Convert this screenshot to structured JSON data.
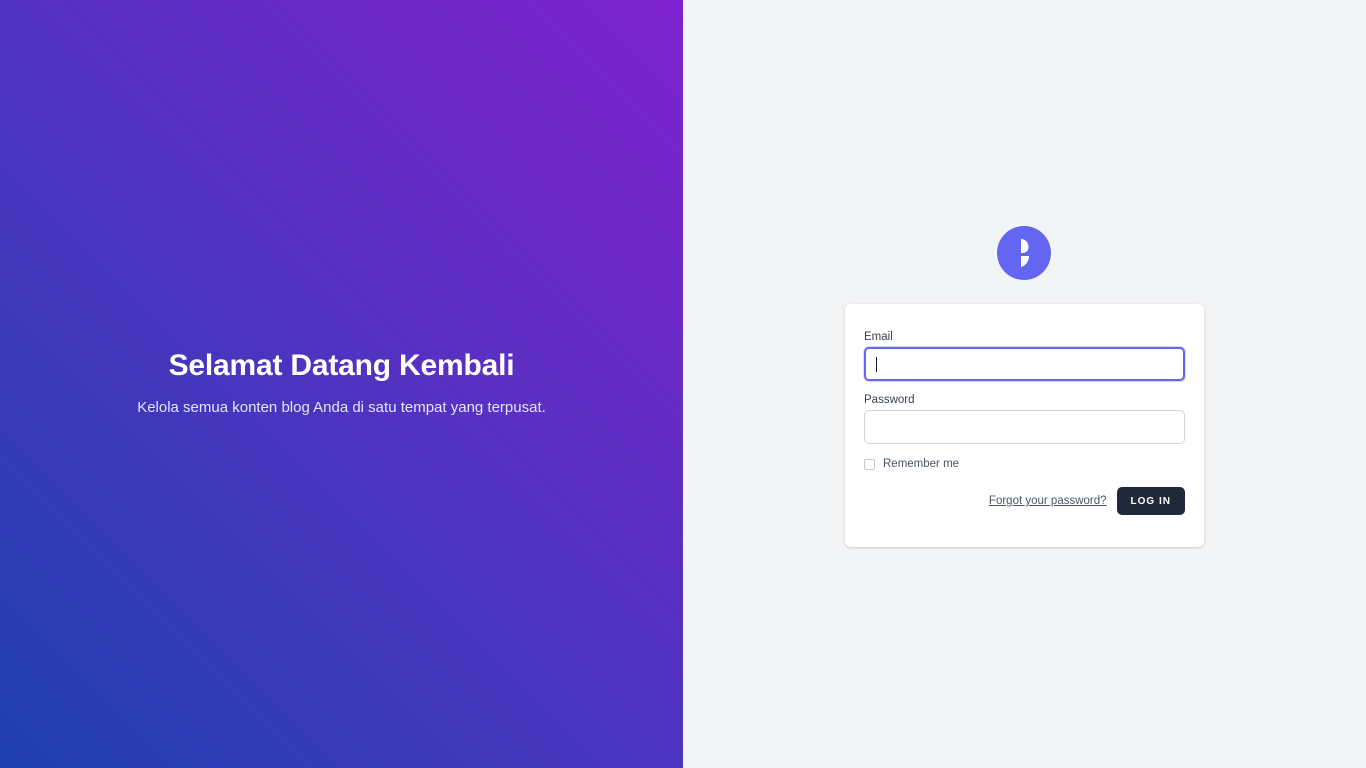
{
  "hero": {
    "title": "Selamat Datang Kembali",
    "subtitle": "Kelola semua konten blog Anda di satu tempat yang terpusat."
  },
  "logo": {
    "icon": "brand-logo-icon",
    "color": "#6366f1"
  },
  "form": {
    "email_label": "Email",
    "email_value": "",
    "password_label": "Password",
    "password_value": "",
    "remember_label": "Remember me",
    "remember_checked": false,
    "forgot_link": "Forgot your password?",
    "login_button": "LOG IN"
  },
  "colors": {
    "accent": "#6366f1",
    "button": "#1f2937",
    "gradient_start": "#1e40af",
    "gradient_end": "#7e22ce",
    "panel_background": "#f3f4f6"
  }
}
